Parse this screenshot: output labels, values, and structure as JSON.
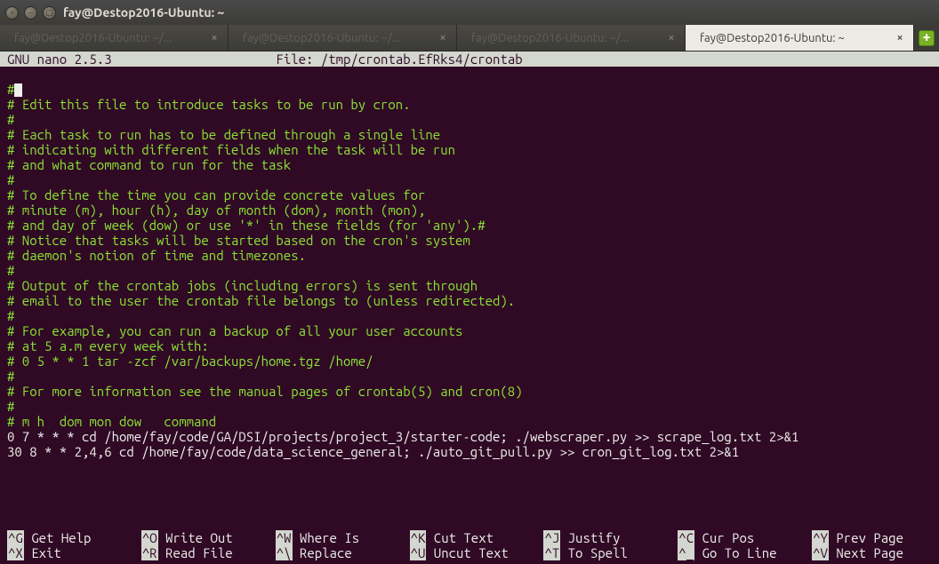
{
  "window": {
    "title": "fay@Destop2016-Ubuntu: ~"
  },
  "tabs": [
    {
      "label": "fay@Destop2016-Ubuntu: ~/..."
    },
    {
      "label": "fay@Destop2016-Ubuntu: ~/..."
    },
    {
      "label": "fay@Destop2016-Ubuntu: ~/..."
    },
    {
      "label": "fay@Destop2016-Ubuntu: ~"
    }
  ],
  "active_tab_index": 3,
  "nano": {
    "version": "GNU nano 2.5.3",
    "file_label": "File:",
    "filename": "/tmp/crontab.EfRks4/crontab",
    "lines": {
      "l0": "#",
      "l1": "# Edit this file to introduce tasks to be run by cron.",
      "l2": "#",
      "l3": "# Each task to run has to be defined through a single line",
      "l4": "# indicating with different fields when the task will be run",
      "l5": "# and what command to run for the task",
      "l6": "#",
      "l7": "# To define the time you can provide concrete values for",
      "l8": "# minute (m), hour (h), day of month (dom), month (mon),",
      "l9": "# and day of week (dow) or use '*' in these fields (for 'any').#",
      "l10": "# Notice that tasks will be started based on the cron's system",
      "l11": "# daemon's notion of time and timezones.",
      "l12": "#",
      "l13": "# Output of the crontab jobs (including errors) is sent through",
      "l14": "# email to the user the crontab file belongs to (unless redirected).",
      "l15": "#",
      "l16": "# For example, you can run a backup of all your user accounts",
      "l17": "# at 5 a.m every week with:",
      "l18": "# 0 5 * * 1 tar -zcf /var/backups/home.tgz /home/",
      "l19": "#",
      "l20": "# For more information see the manual pages of crontab(5) and cron(8)",
      "l21": "#",
      "l22": "# m h  dom mon dow   command",
      "l23": "0 7 * * * cd /home/fay/code/GA/DSI/projects/project_3/starter-code; ./webscraper.py >> scrape_log.txt 2>&1",
      "l24": "30 8 * * 2,4,6 cd /home/fay/code/data_science_general; ./auto_git_pull.py >> cron_git_log.txt 2>&1"
    },
    "shortcuts": {
      "row1": [
        {
          "key": "^G",
          "label": "Get Help"
        },
        {
          "key": "^O",
          "label": "Write Out"
        },
        {
          "key": "^W",
          "label": "Where Is"
        },
        {
          "key": "^K",
          "label": "Cut Text"
        },
        {
          "key": "^J",
          "label": "Justify"
        },
        {
          "key": "^C",
          "label": "Cur Pos"
        },
        {
          "key": "^Y",
          "label": "Prev Page"
        }
      ],
      "row2": [
        {
          "key": "^X",
          "label": "Exit"
        },
        {
          "key": "^R",
          "label": "Read File"
        },
        {
          "key": "^\\",
          "label": "Replace"
        },
        {
          "key": "^U",
          "label": "Uncut Text"
        },
        {
          "key": "^T",
          "label": "To Spell"
        },
        {
          "key": "^_",
          "label": "Go To Line"
        },
        {
          "key": "^V",
          "label": "Next Page"
        }
      ]
    }
  }
}
